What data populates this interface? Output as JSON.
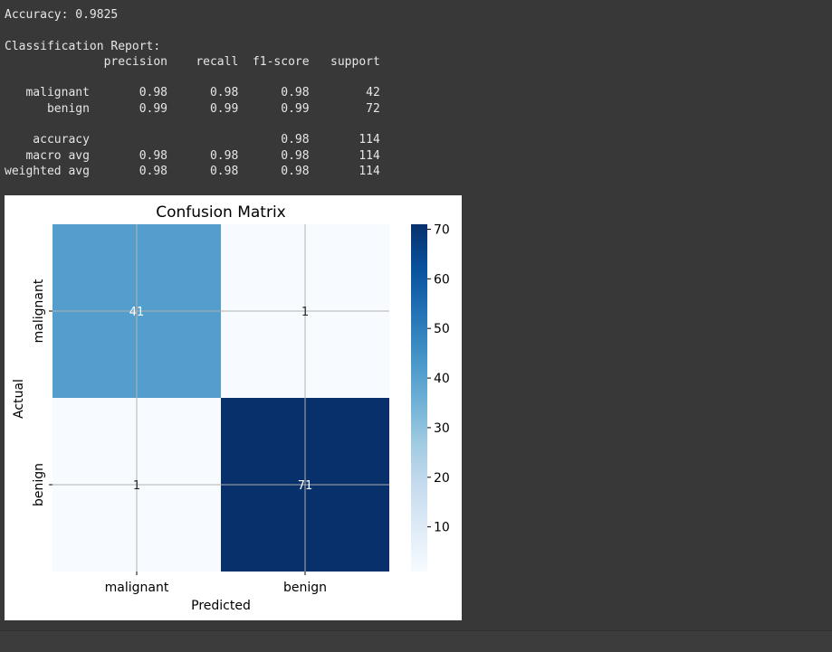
{
  "console": {
    "lines": [
      "Accuracy: 0.9825",
      "",
      "Classification Report:",
      "              precision    recall  f1-score   support",
      "",
      "   malignant       0.98      0.98      0.98        42",
      "      benign       0.99      0.99      0.99        72",
      "",
      "    accuracy                           0.98       114",
      "   macro avg       0.98      0.98      0.98       114",
      "weighted avg       0.98      0.98      0.98       114"
    ]
  },
  "chart_data": {
    "type": "heatmap",
    "title": "Confusion Matrix",
    "xlabel": "Predicted",
    "ylabel": "Actual",
    "x_categories": [
      "malignant",
      "benign"
    ],
    "y_categories": [
      "malignant",
      "benign"
    ],
    "values": [
      [
        41,
        1
      ],
      [
        1,
        71
      ]
    ],
    "colormap": "Blues",
    "colorbar": {
      "min": 1,
      "max": 71,
      "ticks": [
        10,
        20,
        30,
        40,
        50,
        60,
        70
      ]
    },
    "grid": true,
    "colors": {
      "low": "#f7fbff",
      "mid": "#4b9ccd",
      "high": "#08306b"
    }
  }
}
